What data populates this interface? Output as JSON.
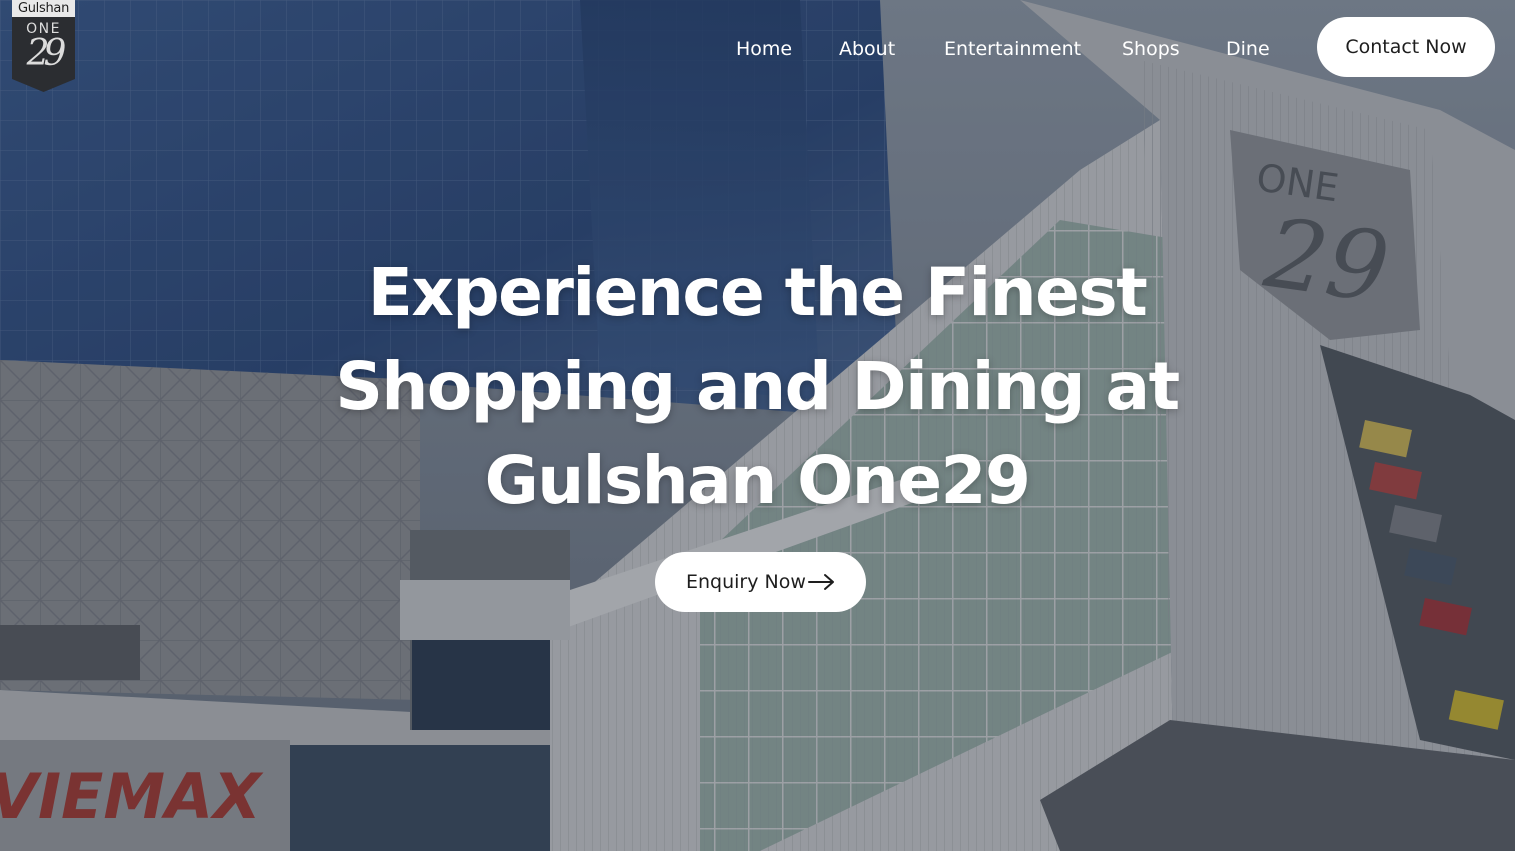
{
  "brand": {
    "logo_top_text": "Gulshan",
    "logo_one_text": "ONE",
    "logo_number": "29"
  },
  "nav": {
    "items": [
      {
        "label": "Home"
      },
      {
        "label": "About"
      },
      {
        "label": "Entertainment"
      },
      {
        "label": "Shops"
      },
      {
        "label": "Dine"
      }
    ],
    "contact_label": "Contact Now"
  },
  "hero": {
    "headline_lines": [
      "Experience the Finest",
      "Shopping and Dining at",
      "Gulshan One29"
    ],
    "cta_label": "Enquiry Now",
    "cta_icon": "arrow-right-icon",
    "background": "mall-building-photo"
  },
  "colors": {
    "button_bg": "#ffffff",
    "button_text": "#1e1e1e",
    "nav_text": "#ffffff",
    "logo_shield": "#2b2d31"
  }
}
